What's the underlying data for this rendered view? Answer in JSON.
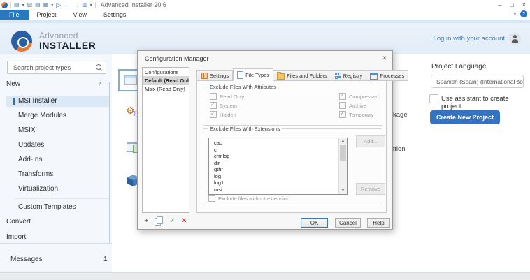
{
  "titlebar": {
    "app_title": "Advanced Installer 20.6",
    "qat_icons": [
      "▤",
      "▾",
      "▨",
      "▤",
      "▦",
      "▾",
      "▷",
      "←",
      "→",
      "▥",
      "▾"
    ],
    "minimize": "–",
    "maximize": "□",
    "close": "×"
  },
  "menubar": {
    "tabs": [
      "File",
      "Project",
      "View",
      "Settings"
    ],
    "collapse_glyph": "∨",
    "help_glyph": "?"
  },
  "header": {
    "brand_line1": "Advanced",
    "brand_line2": "INSTALLER",
    "login_text": "Log in with your account"
  },
  "sidebar": {
    "search_text": "Search project types",
    "new_section": "New",
    "collapse_glyph": "∧",
    "items": [
      "MSI Installer",
      "Merge Modules",
      "MSIX",
      "Updates",
      "Add-Ins",
      "Transforms",
      "Virtualization",
      "Custom Templates"
    ],
    "selected_item": "MSI Installer",
    "sections": [
      "Convert",
      "Import"
    ],
    "dash": "-",
    "messages_label": "Messages",
    "messages_count": "1"
  },
  "content": {
    "fragments": [
      "kage",
      "ation"
    ]
  },
  "right_panel": {
    "language_label": "Project Language",
    "language_value": "Spanish (Spain) (International so",
    "dropdown_glyph": "∨",
    "assistant_label": "Use assistant to create project.",
    "create_button": "Create New Project"
  },
  "dialog": {
    "title": "Configuration Manager",
    "close_glyph": "×",
    "list_header": "Configurations",
    "configurations": [
      "Default (Read Only)",
      "Msix (Read Only)"
    ],
    "selected_configuration": "Default (Read Only)",
    "tabs": [
      "Settings",
      "File Types",
      "Files and Folders",
      "Registry",
      "Processes"
    ],
    "active_tab": "File Types",
    "attributes_group": {
      "title": "Exclude Files With Attributes",
      "checkboxes": [
        {
          "label": "Read Only",
          "checked": false
        },
        {
          "label": "System",
          "checked": true
        },
        {
          "label": "Hidden",
          "checked": true
        },
        {
          "label": "Compressed",
          "checked": true
        },
        {
          "label": "Archive",
          "checked": false
        },
        {
          "label": "Temporary",
          "checked": true
        }
      ]
    },
    "extensions_group": {
      "title": "Exclude Files With Extensions",
      "extensions": [
        "cab",
        "ci",
        "crmlog",
        "dir",
        "gthr",
        "log",
        "log1",
        "msi"
      ],
      "scroll_up_glyph": "▲",
      "scroll_down_glyph": "▼",
      "add_button": "Add...",
      "remove_button": "Remove",
      "no_extension_label": "Exclude files without extension"
    },
    "toolbar": {
      "add_glyph": "+",
      "apply_glyph": "✓",
      "delete_glyph": "×"
    },
    "ok": "OK",
    "cancel": "Cancel",
    "help": "Help"
  },
  "colors": {
    "accent_blue": "#2878bd",
    "link_blue": "#3c7fc0",
    "button_blue": "#3472c4",
    "selection_blue": "#dbe9f6"
  }
}
